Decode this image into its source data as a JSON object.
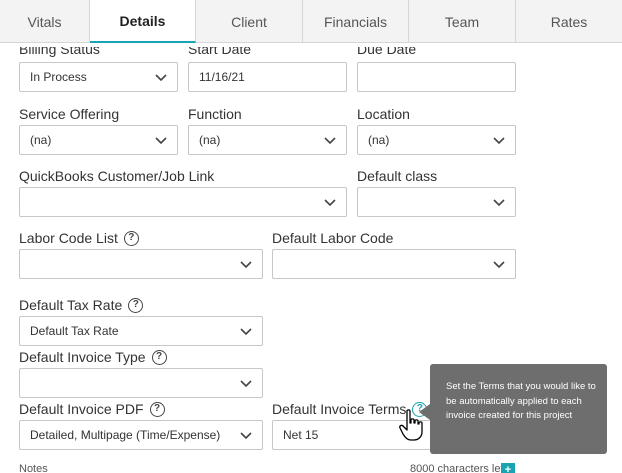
{
  "tabs": [
    {
      "label": "Vitals",
      "active": false
    },
    {
      "label": "Details",
      "active": true
    },
    {
      "label": "Client",
      "active": false
    },
    {
      "label": "Financials",
      "active": false
    },
    {
      "label": "Team",
      "active": false
    },
    {
      "label": "Rates",
      "active": false
    }
  ],
  "form": {
    "billing_status": {
      "label": "Billing Status",
      "value": "In Process"
    },
    "start_date": {
      "label": "Start Date",
      "value": "11/16/21"
    },
    "due_date": {
      "label": "Due Date",
      "value": ""
    },
    "service_offering": {
      "label": "Service Offering",
      "value": "(na)"
    },
    "function": {
      "label": "Function",
      "value": "(na)"
    },
    "location": {
      "label": "Location",
      "value": "(na)"
    },
    "qb_link": {
      "label": "QuickBooks Customer/Job Link",
      "value": ""
    },
    "default_class": {
      "label": "Default class",
      "value": ""
    },
    "labor_code_list": {
      "label": "Labor Code List",
      "value": ""
    },
    "default_labor_code": {
      "label": "Default Labor Code",
      "value": ""
    },
    "default_tax_rate": {
      "label": "Default Tax Rate",
      "value": "Default Tax Rate"
    },
    "default_invoice_type": {
      "label": "Default Invoice Type",
      "value": ""
    },
    "default_invoice_pdf": {
      "label": "Default Invoice PDF",
      "value": "Detailed, Multipage (Time/Expense)"
    },
    "default_invoice_terms": {
      "label": "Default Invoice Terms",
      "value": "Net 15"
    },
    "notes": {
      "label": "Notes",
      "chars_left": "8000 characters left"
    }
  },
  "tooltip": {
    "text": "Set the Terms that you would like to be automatically applied to each invoice created for this project"
  },
  "icons": {
    "help": "help-circle-icon",
    "chevron": "chevron-down-icon",
    "cursor": "hand-pointer-icon",
    "plus": "plus-icon"
  },
  "colors": {
    "accent": "#1aa3b0",
    "tooltip_bg": "#6e6e6e"
  }
}
